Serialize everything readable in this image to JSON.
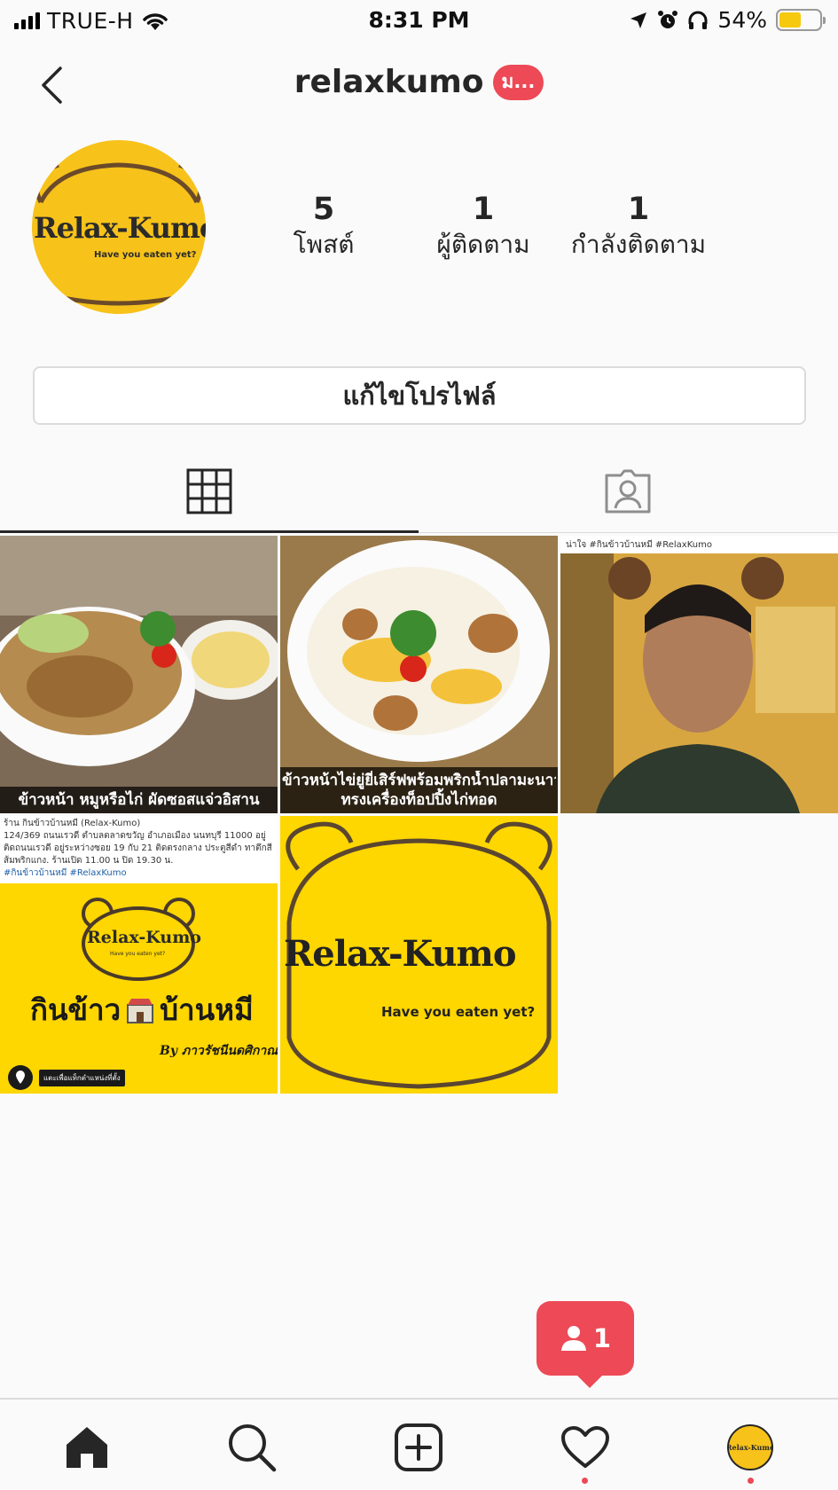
{
  "status_bar": {
    "carrier": "TRUE-H",
    "time": "8:31 PM",
    "battery_percent": "54%",
    "battery_level": 0.54,
    "icons": [
      "signal-icon",
      "wifi-icon",
      "location-arrow-icon",
      "alarm-icon",
      "headphones-icon",
      "battery-icon"
    ]
  },
  "header": {
    "username": "relaxkumo",
    "notification_pill": "ม..."
  },
  "profile": {
    "avatar_text": "Relax-Kumo",
    "avatar_tagline": "Have you eaten yet?",
    "stats": [
      {
        "value": "5",
        "label": "โพสต์"
      },
      {
        "value": "1",
        "label": "ผู้ติดตาม"
      },
      {
        "value": "1",
        "label": "กำลังติดตาม"
      }
    ],
    "edit_button": "แก้ไขโปรไฟล์"
  },
  "tabs": [
    {
      "icon": "grid-icon",
      "active": true
    },
    {
      "icon": "tagged-person-icon",
      "active": false
    }
  ],
  "posts": [
    {
      "caption": "ข้าวหน้า หมูหรือไก่ ผัดซอสแจ่วอิสาน"
    },
    {
      "caption_line1": "ข้าวหน้าไข่ยู่ยี่เสิร์ฟพร้อมพริกน้ำปลามะนาว",
      "caption_line2": "ทรงเครื่องท็อปปิ้งไก่ทอด"
    },
    {
      "header_text": "น่าใจ #กินข้าวบ้านหมี #RelaxKumo"
    },
    {
      "info_title": "ร้าน กินข้าวบ้านหมี (Relax-Kumo)",
      "info_address": "124/369 ถนนเรวดี ตำบลตลาดขวัญ อำเภอเมือง นนทบุรี 11000 อยู่ติดถนนเรวดี อยู่ระหว่างซอย 19 กับ 21 ติดตรงกลาง ประตูสีดำ ทาตึกสีส้มพริกแกง. ร้านเปิด 11.00 น ปิด 19.30 น.",
      "info_tags": "#กินข้าวบ้านหมี #RelaxKumo",
      "logo_text": "Relax-Kumo",
      "logo_tagline": "Have you eaten yet?",
      "banner_left": "กินข้าว",
      "banner_right": "บ้านหมี",
      "by_line": "By ภาวรัชนีนดศิกาณต์",
      "location_label": "แตะเพื่อแท็กตำแหน่งที่ตั้ง"
    },
    {
      "logo_text": "Relax-Kumo",
      "tagline": "Have you eaten yet?"
    }
  ],
  "follow_notification": {
    "count": "1"
  },
  "bottom_nav": [
    {
      "icon": "home-icon"
    },
    {
      "icon": "search-icon"
    },
    {
      "icon": "add-post-icon"
    },
    {
      "icon": "heart-icon"
    },
    {
      "icon": "profile-avatar-icon"
    }
  ],
  "colors": {
    "accent_red": "#ed4956",
    "brand_yellow": "#f7c21a",
    "text": "#262626",
    "border": "#dbdbdb"
  }
}
